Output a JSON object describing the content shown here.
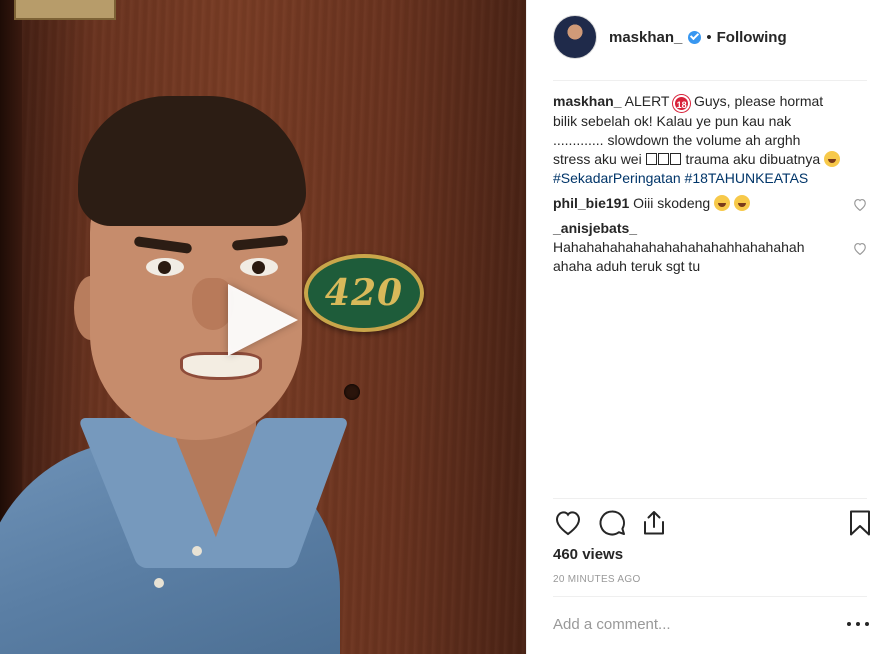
{
  "media": {
    "room_number": "420",
    "play_icon": "play-icon"
  },
  "header": {
    "username": "maskhan_",
    "verified_icon": "verified-badge-icon",
    "separator": "•",
    "follow_status": "Following"
  },
  "caption": {
    "author": "maskhan_",
    "text_1": " ALERT ",
    "text_2": " Guys, please hormat bilik sebelah ok! Kalau ye pun kau nak ............. slowdown the volume ah arghh stress aku wei ",
    "text_3": " trauma aku dibuatnya ",
    "hashtags": [
      "#SekadarPeringatan",
      "#18TAHUNKEATAS"
    ]
  },
  "comments": [
    {
      "author": "phil_bie191",
      "text": "Oiii skodeng "
    },
    {
      "author": "_anisjebats_",
      "text": "Hahahahahahahahahahahahhahahahah ahaha aduh teruk sgt tu"
    }
  ],
  "stats": {
    "views": "460 views",
    "timestamp": "20 MINUTES AGO"
  },
  "add_comment": {
    "placeholder": "Add a comment..."
  },
  "icons": {
    "like": "heart-icon",
    "comment": "comment-icon",
    "share": "share-icon",
    "save": "bookmark-icon",
    "more": "more-options-icon"
  },
  "colors": {
    "verified": "#3897f0",
    "hashtag": "#003569",
    "muted": "#999999",
    "text": "#262626"
  }
}
